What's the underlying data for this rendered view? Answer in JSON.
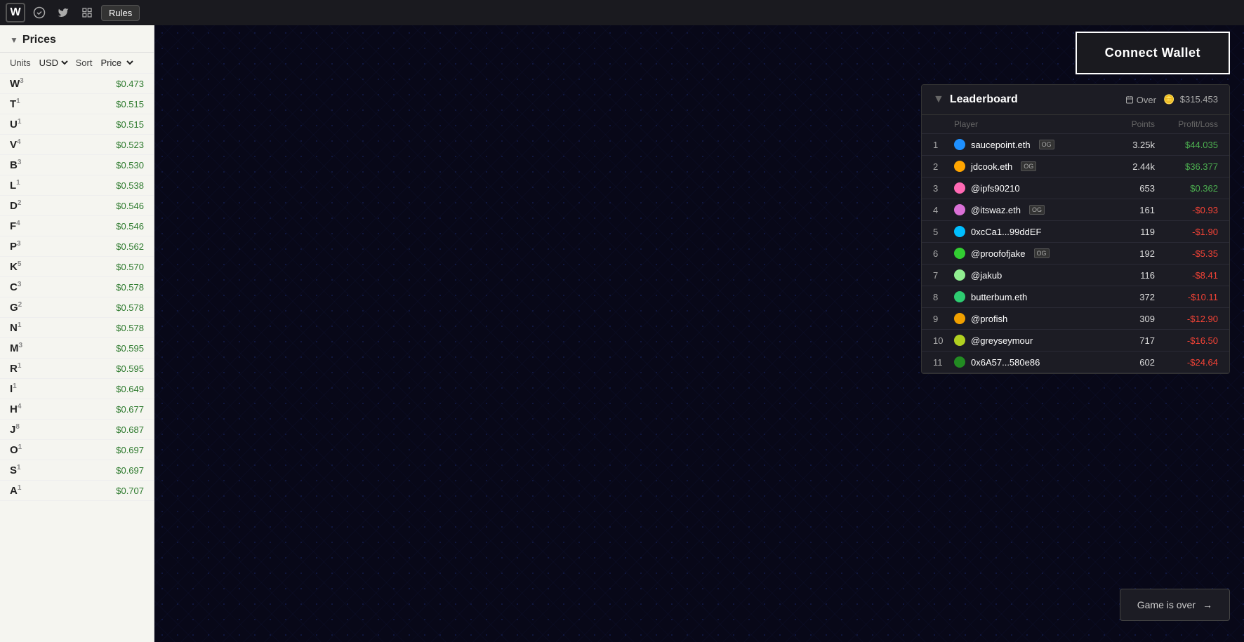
{
  "nav": {
    "logo": "W",
    "icons": [
      "W",
      "T",
      "B"
    ],
    "rules_label": "Rules"
  },
  "prices": {
    "title": "Prices",
    "units_label": "Units",
    "units_value": "USD",
    "sort_label": "Sort",
    "sort_value": "Price",
    "items": [
      {
        "letter": "W",
        "sub": "3",
        "value": "$0.473"
      },
      {
        "letter": "T",
        "sub": "1",
        "value": "$0.515"
      },
      {
        "letter": "U",
        "sub": "1",
        "value": "$0.515"
      },
      {
        "letter": "V",
        "sub": "4",
        "value": "$0.523"
      },
      {
        "letter": "B",
        "sub": "3",
        "value": "$0.530"
      },
      {
        "letter": "L",
        "sub": "1",
        "value": "$0.538"
      },
      {
        "letter": "D",
        "sub": "2",
        "value": "$0.546"
      },
      {
        "letter": "F",
        "sub": "4",
        "value": "$0.546"
      },
      {
        "letter": "P",
        "sub": "3",
        "value": "$0.562"
      },
      {
        "letter": "K",
        "sub": "5",
        "value": "$0.570"
      },
      {
        "letter": "C",
        "sub": "3",
        "value": "$0.578"
      },
      {
        "letter": "G",
        "sub": "2",
        "value": "$0.578"
      },
      {
        "letter": "N",
        "sub": "1",
        "value": "$0.578"
      },
      {
        "letter": "M",
        "sub": "3",
        "value": "$0.595"
      },
      {
        "letter": "R",
        "sub": "1",
        "value": "$0.595"
      },
      {
        "letter": "I",
        "sub": "1",
        "value": "$0.649"
      },
      {
        "letter": "H",
        "sub": "4",
        "value": "$0.677"
      },
      {
        "letter": "J",
        "sub": "8",
        "value": "$0.687"
      },
      {
        "letter": "O",
        "sub": "1",
        "value": "$0.697"
      },
      {
        "letter": "S",
        "sub": "1",
        "value": "$0.697"
      },
      {
        "letter": "A",
        "sub": "1",
        "value": "$0.707"
      }
    ]
  },
  "connect_wallet": {
    "label": "Connect Wallet"
  },
  "leaderboard": {
    "title": "Leaderboard",
    "over_label": "Over",
    "total_value": "$315.453",
    "col_player": "Player",
    "col_points": "Points",
    "col_profit": "Profit/Loss",
    "rows": [
      {
        "rank": 1,
        "name": "saucepoint.eth",
        "badge": "OG",
        "avatar_color": "#1e90ff",
        "points": "3.25k",
        "profit": "$44.035",
        "profit_type": "pos"
      },
      {
        "rank": 2,
        "name": "jdcook.eth",
        "badge": "OG",
        "avatar_color": "#ffa500",
        "points": "2.44k",
        "profit": "$36.377",
        "profit_type": "pos"
      },
      {
        "rank": 3,
        "name": "@ipfs90210",
        "badge": "",
        "avatar_color": "#ff69b4",
        "points": "653",
        "profit": "$0.362",
        "profit_type": "pos"
      },
      {
        "rank": 4,
        "name": "@itswaz.eth",
        "badge": "OG",
        "avatar_color": "#da70d6",
        "points": "161",
        "profit": "-$0.93",
        "profit_type": "neg"
      },
      {
        "rank": 5,
        "name": "0xcCa1...99ddEF",
        "badge": "",
        "avatar_color": "#00bfff",
        "points": "119",
        "profit": "-$1.90",
        "profit_type": "neg"
      },
      {
        "rank": 6,
        "name": "@proofofjake",
        "badge": "OG",
        "avatar_color": "#32cd32",
        "points": "192",
        "profit": "-$5.35",
        "profit_type": "neg"
      },
      {
        "rank": 7,
        "name": "@jakub",
        "badge": "",
        "avatar_color": "#90ee90",
        "points": "116",
        "profit": "-$8.41",
        "profit_type": "neg"
      },
      {
        "rank": 8,
        "name": "butterbum.eth",
        "badge": "",
        "avatar_color": "#2ecc71",
        "points": "372",
        "profit": "-$10.11",
        "profit_type": "neg"
      },
      {
        "rank": 9,
        "name": "@profish",
        "badge": "",
        "avatar_color": "#f0a000",
        "points": "309",
        "profit": "-$12.90",
        "profit_type": "neg"
      },
      {
        "rank": 10,
        "name": "@greyseymour",
        "badge": "",
        "avatar_color": "#b0d020",
        "points": "717",
        "profit": "-$16.50",
        "profit_type": "neg"
      },
      {
        "rank": 11,
        "name": "0x6A57...580e86",
        "badge": "",
        "avatar_color": "#228b22",
        "points": "602",
        "profit": "-$24.64",
        "profit_type": "neg"
      }
    ]
  },
  "game_over": {
    "label": "Game is over",
    "arrow": "→"
  }
}
